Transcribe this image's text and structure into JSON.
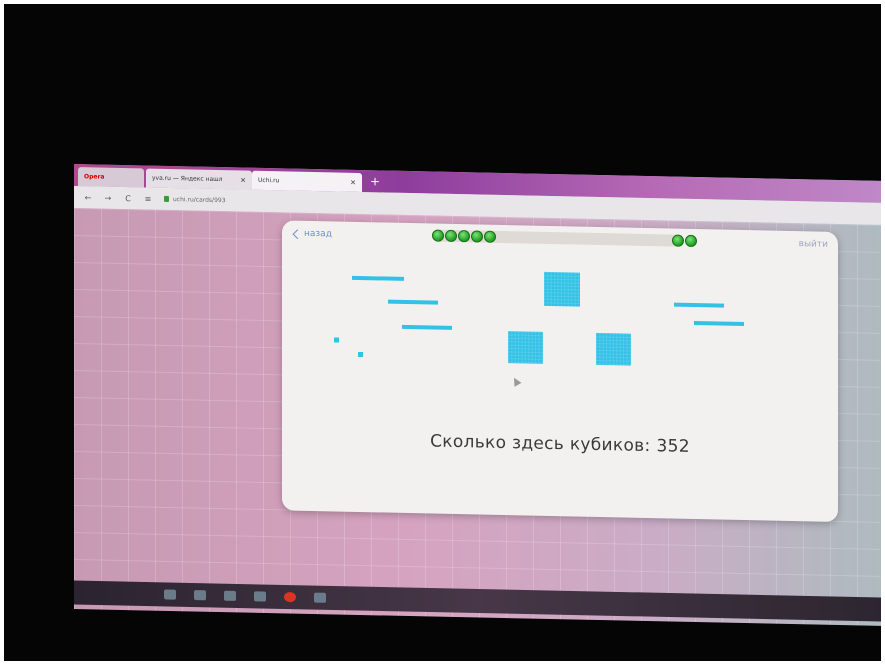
{
  "browser": {
    "tabs": [
      {
        "label": "Opera"
      },
      {
        "label": "yva.ru — Яндекс нашл"
      },
      {
        "label": "Uchi.ru"
      }
    ],
    "new_tab_symbol": "+",
    "close_symbol": "✕",
    "nav": {
      "back": "←",
      "forward": "→",
      "reload": "C",
      "menu": "≡"
    },
    "url": "uchi.ru/cards/993"
  },
  "card": {
    "back_label": "назад",
    "exit_label": "выйти",
    "progress_main_dots": 5,
    "progress_side_dots": 2,
    "question_text": "Сколько здесь кубиков:",
    "answer_value": "352"
  },
  "colors": {
    "accent": "#33c2e6",
    "progress_green": "#1e9e1e",
    "link": "#6a8fc7"
  }
}
